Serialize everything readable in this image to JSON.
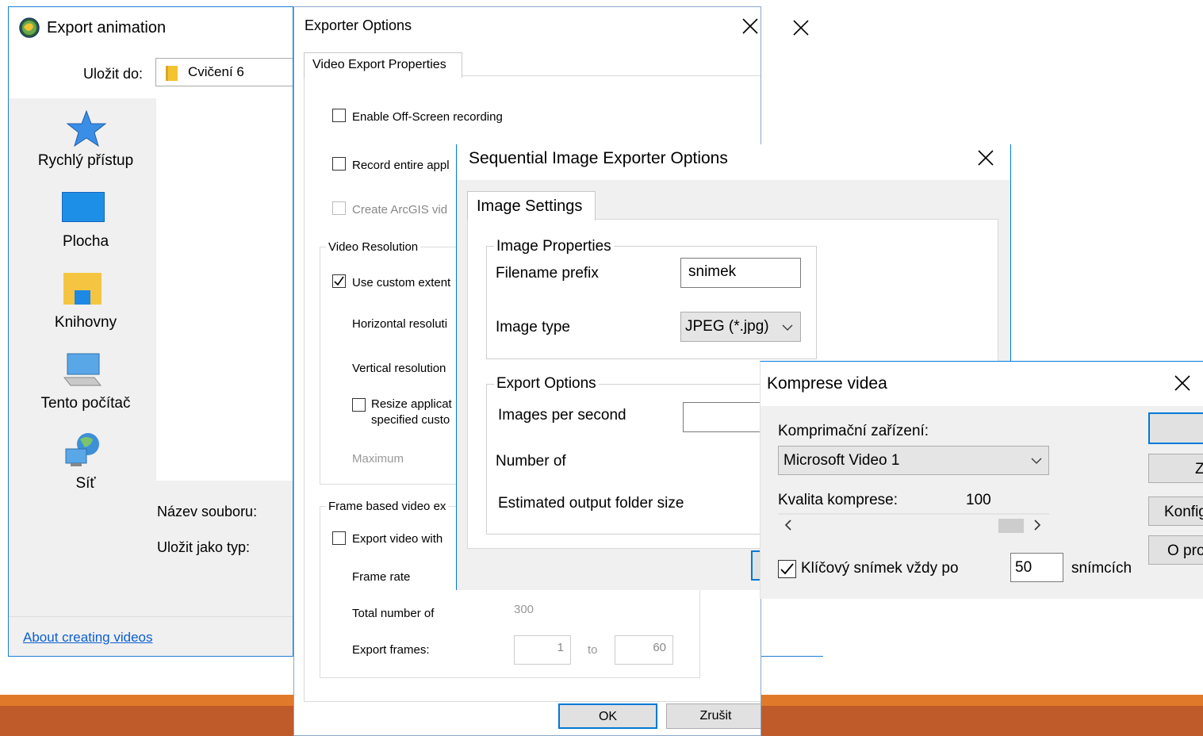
{
  "background": {
    "orange": "#e07a2a",
    "dark_orange": "#bf5a2a"
  },
  "export_animation": {
    "title": "Export animation",
    "save_in_label": "Uložit do:",
    "save_in_value": "Cvičení 6",
    "nav_items": [
      {
        "label": "Rychlý přístup",
        "icon": "star-icon"
      },
      {
        "label": "Plocha",
        "icon": "desktop-icon"
      },
      {
        "label": "Knihovny",
        "icon": "library-folder-icon"
      },
      {
        "label": "Tento počítač",
        "icon": "computer-icon"
      },
      {
        "label": "Síť",
        "icon": "network-globe-icon"
      }
    ],
    "filename_label": "Název souboru:",
    "save_as_type_label": "Uložit jako typ:",
    "about_link": "About creating videos"
  },
  "exporter_options": {
    "title": "Exporter Options",
    "tab": "Video Export Properties",
    "enable_offscreen": {
      "label": "Enable Off-Screen recording",
      "checked": false
    },
    "record_entire": {
      "label": "Record entire appl",
      "checked": false
    },
    "create_arcgis": {
      "label": "Create ArcGIS vid",
      "checked": false,
      "disabled": true
    },
    "video_resolution": {
      "group_label": "Video Resolution",
      "use_custom": {
        "label": "Use custom extent",
        "checked": true
      },
      "horizontal_label": "Horizontal resoluti",
      "vertical_label": "Vertical resolution",
      "resize_line1": "Resize applicat",
      "resize_line2": "specified custo",
      "maximum_label": "Maximum"
    },
    "frame_based": {
      "group_label": "Frame based video ex",
      "export_with": {
        "label": "Export video with",
        "checked": false
      },
      "frame_rate_label": "Frame rate",
      "total_label": "Total number of",
      "total_value": "300",
      "export_frames_label": "Export frames:",
      "from_value": "1",
      "to_label": "to",
      "to_value": "60"
    },
    "ok": "OK",
    "cancel": "Zrušit"
  },
  "sequential": {
    "title": "Sequential Image Exporter Options",
    "tab": "Image Settings",
    "image_properties": {
      "group_label": "Image Properties",
      "prefix_label": "Filename prefix",
      "prefix_value": "snimek",
      "type_label": "Image type",
      "type_value": "JPEG (*.jpg)"
    },
    "export_options": {
      "group_label": "Export Options",
      "ips_label": "Images per second",
      "number_label": "Number of",
      "estimated_label": "Estimated output folder size"
    }
  },
  "komprese": {
    "title": "Komprese videa",
    "device_label": "Komprimační zařízení:",
    "device_value": "Microsoft Video 1",
    "quality_label": "Kvalita komprese:",
    "quality_value": "100",
    "quality_fraction": 1.0,
    "keyframe": {
      "label": "Klíčový snímek vždy po",
      "checked": true,
      "value": "50",
      "unit": "snímcích"
    },
    "btn_ok": "",
    "btn_cancel": "Z",
    "btn_config": "Konfig",
    "btn_about": "O pro"
  }
}
